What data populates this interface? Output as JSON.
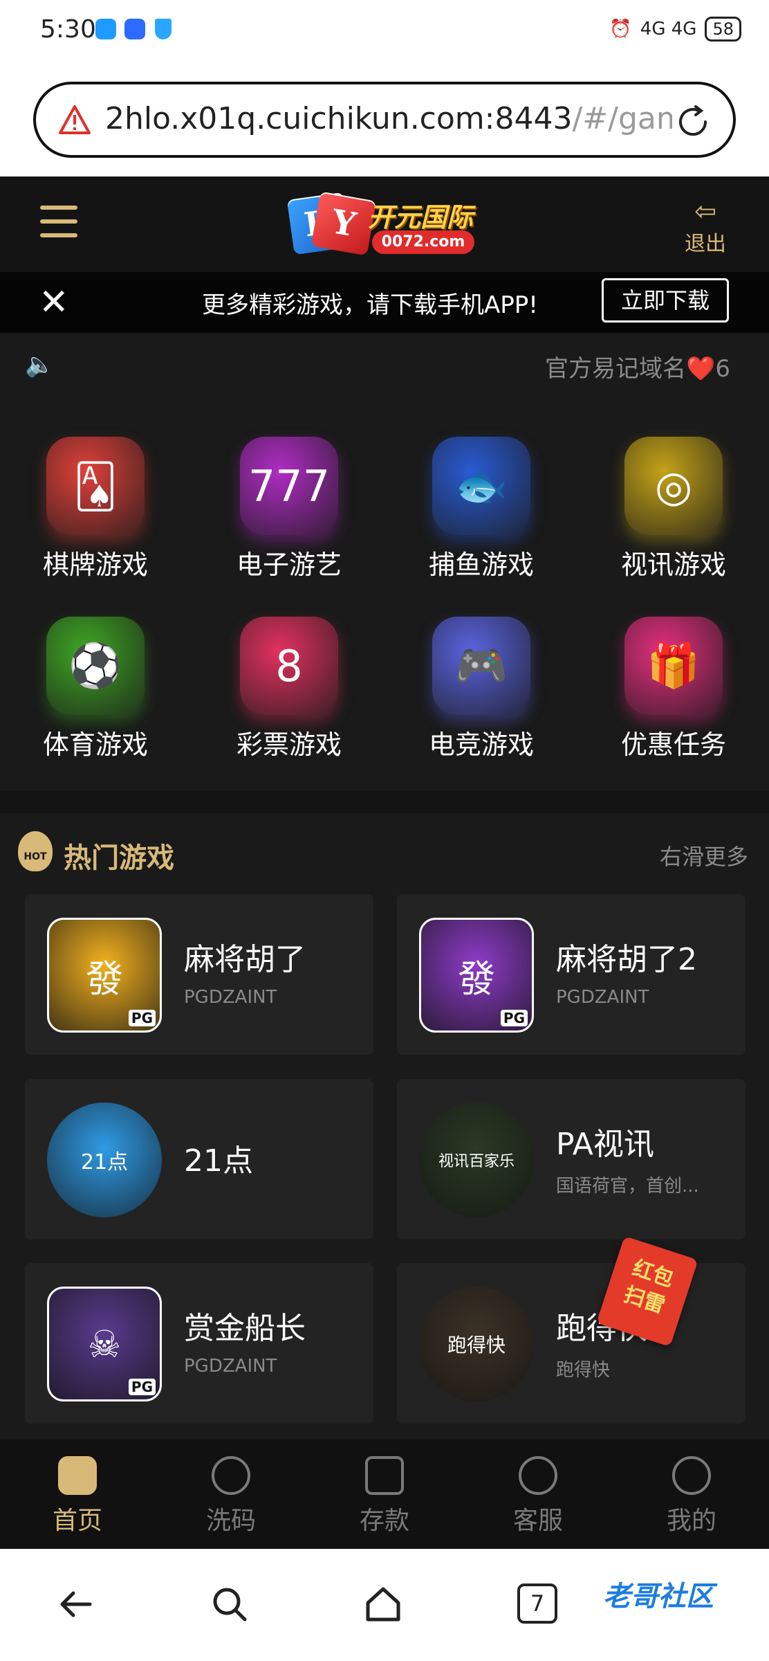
{
  "status_bar": {
    "time": "5:30",
    "signal": "4G 4G",
    "battery": "58"
  },
  "browser": {
    "url_host": "2hlo.x01q.cuichikun.com:8443",
    "url_path": "/#/gam",
    "security_icon": "warning-icon",
    "reload_icon": "reload-icon"
  },
  "header": {
    "logo_mark": "KY",
    "logo_name": "开元国际",
    "logo_site": "0072.com",
    "logout_label": "退出"
  },
  "banner": {
    "message": "更多精彩游戏，请下载手机APP!",
    "download_label": "立即下载"
  },
  "notice": {
    "text": "官方易记域名❤️6"
  },
  "categories": [
    {
      "label": "棋牌游戏",
      "icon": "cards-icon",
      "glyph": "🂡",
      "color": "#e0403a"
    },
    {
      "label": "电子游艺",
      "icon": "slot-icon",
      "glyph": "777",
      "color": "#b02cc4"
    },
    {
      "label": "捕鱼游戏",
      "icon": "fish-icon",
      "glyph": "🐟",
      "color": "#2a5bd4"
    },
    {
      "label": "视讯游戏",
      "icon": "roulette-icon",
      "glyph": "◎",
      "color": "#c4a317"
    },
    {
      "label": "体育游戏",
      "icon": "soccer-icon",
      "glyph": "⚽",
      "color": "#3fa624"
    },
    {
      "label": "彩票游戏",
      "icon": "billiard-icon",
      "glyph": "8",
      "color": "#e2315f"
    },
    {
      "label": "电竞游戏",
      "icon": "gamepad-icon",
      "glyph": "🎮",
      "color": "#5a63e0"
    },
    {
      "label": "优惠任务",
      "icon": "gift-icon",
      "glyph": "🎁",
      "color": "#e62e7f"
    }
  ],
  "hot": {
    "title": "热门游戏",
    "badge": "HOT",
    "more_label": "右滑更多",
    "games": [
      {
        "name": "麻将胡了",
        "sub": "PGDZAINT",
        "glyph": "發",
        "color": "#f3b11f",
        "pg": "PG"
      },
      {
        "name": "麻将胡了2",
        "sub": "PGDZAINT",
        "glyph": "發",
        "color": "#8e3cc9",
        "pg": "PG"
      },
      {
        "name": "21点",
        "sub": "",
        "glyph": "21点",
        "color": "#2f9be6"
      },
      {
        "name": "PA视讯",
        "sub": "国语荷官，首创...",
        "glyph": "视讯百家乐",
        "color": "#2a3a24"
      },
      {
        "name": "赏金船长",
        "sub": "PGDZAINT",
        "glyph": "☠",
        "color": "#5a3b8e",
        "pg": "PG"
      },
      {
        "name": "跑得快",
        "sub": "跑得快",
        "glyph": "跑得快",
        "color": "#3c3226"
      }
    ],
    "red_packet": "红包\n扫雷"
  },
  "app_nav": [
    {
      "label": "首页",
      "icon": "home-icon"
    },
    {
      "label": "洗码",
      "icon": "coin-icon"
    },
    {
      "label": "存款",
      "icon": "deposit-icon"
    },
    {
      "label": "客服",
      "icon": "support-icon"
    },
    {
      "label": "我的",
      "icon": "user-icon"
    }
  ],
  "system_nav": {
    "tab_count": "7",
    "watermark": "老哥社区"
  }
}
